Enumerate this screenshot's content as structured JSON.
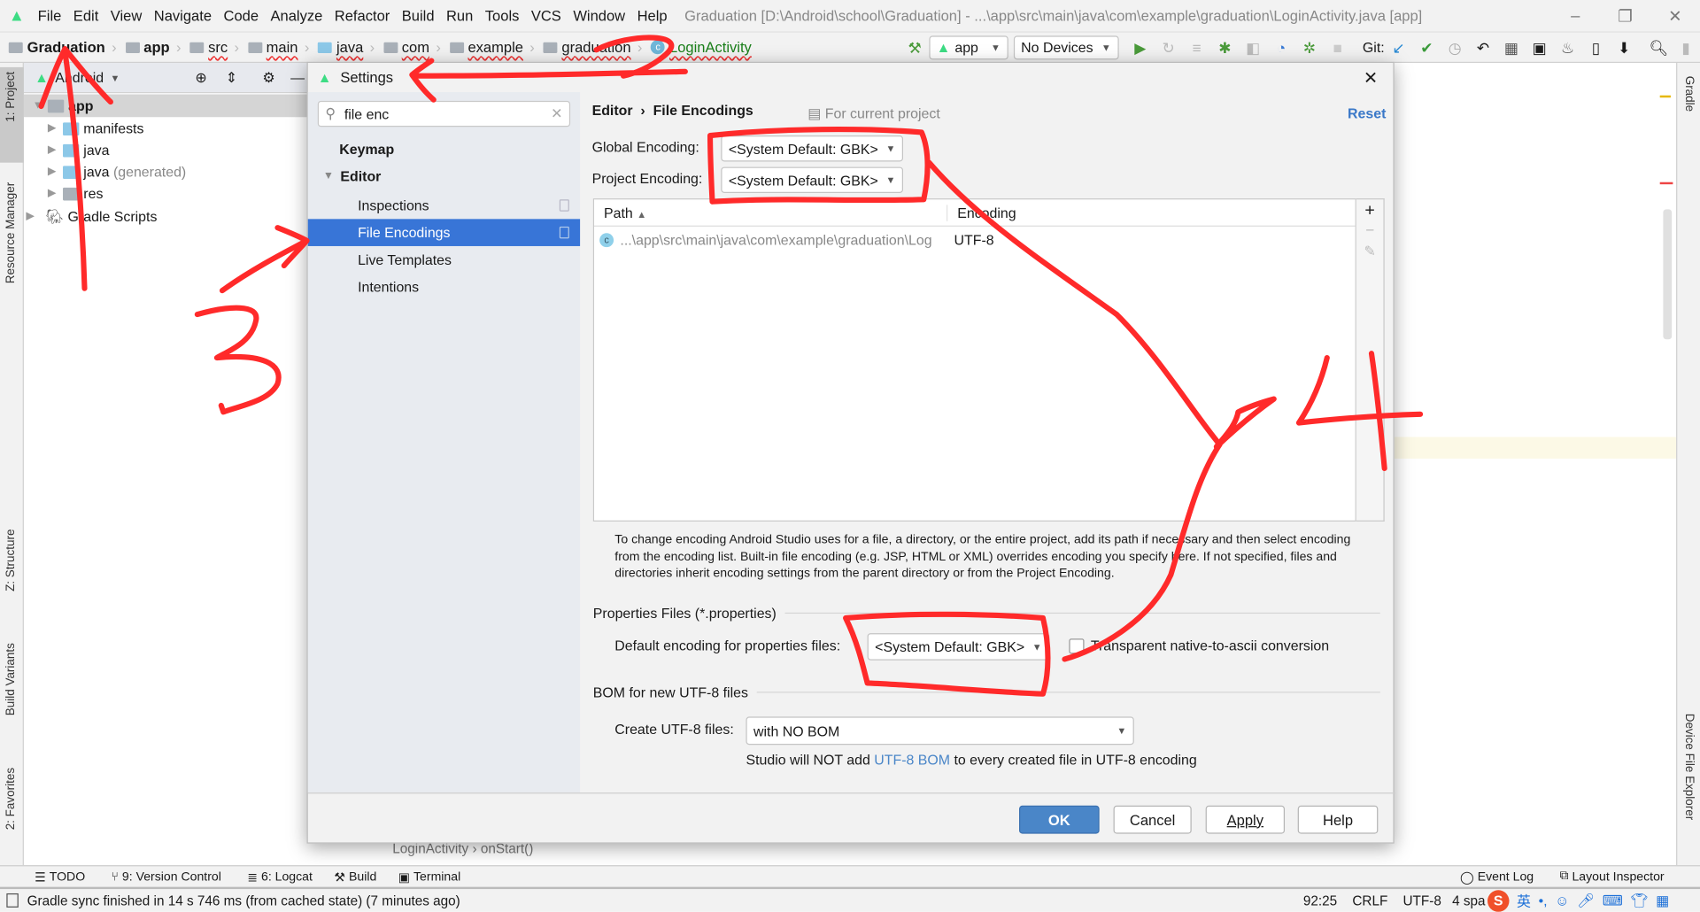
{
  "window": {
    "title": "Graduation [D:\\Android\\school\\Graduation] - ...\\app\\src\\main\\java\\com\\example\\graduation\\LoginActivity.java [app]",
    "menu": [
      "File",
      "Edit",
      "View",
      "Navigate",
      "Code",
      "Analyze",
      "Refactor",
      "Build",
      "Run",
      "Tools",
      "VCS",
      "Window",
      "Help"
    ],
    "controls": {
      "minimize": "–",
      "restore": "❐",
      "close": "✕"
    }
  },
  "navbar": {
    "breadcrumbs": [
      "Graduation",
      "app",
      "src",
      "main",
      "java",
      "com",
      "example",
      "graduation",
      "LoginActivity"
    ],
    "run_config": "app",
    "device": "No Devices",
    "git_label": "Git:"
  },
  "left_strip": [
    "1: Project",
    "Resource Manager",
    "Z: Structure",
    "Build Variants",
    "2: Favorites"
  ],
  "right_strip": [
    "Gradle",
    "Device File Explorer"
  ],
  "project": {
    "view": "Android",
    "tree": [
      {
        "label": "app",
        "bold": true
      },
      {
        "label": "manifests"
      },
      {
        "label": "java"
      },
      {
        "label": "java",
        "suffix": "(generated)"
      },
      {
        "label": "res"
      },
      {
        "label": "Gradle Scripts"
      }
    ]
  },
  "editor": {
    "breadcrumb": [
      "LoginActivity",
      "onStart()"
    ]
  },
  "dialog": {
    "title": "Settings",
    "search_value": "file enc",
    "nav": [
      {
        "label": "Keymap"
      },
      {
        "label": "Editor"
      },
      {
        "label": "Inspections"
      },
      {
        "label": "File Encodings",
        "selected": true
      },
      {
        "label": "Live Templates"
      },
      {
        "label": "Intentions"
      }
    ],
    "breadcrumb": [
      "Editor",
      "File Encodings"
    ],
    "scope": "For current project",
    "reset": "Reset",
    "global_encoding_label": "Global Encoding:",
    "global_encoding_value": "<System Default: GBK>",
    "project_encoding_label": "Project Encoding:",
    "project_encoding_value": "<System Default: GBK>",
    "table": {
      "columns": [
        "Path",
        "Encoding"
      ],
      "rows": [
        {
          "path": "...\\app\\src\\main\\java\\com\\example\\graduation\\Log",
          "encoding": "UTF-8"
        }
      ]
    },
    "description": "To change encoding Android Studio uses for a file, a directory, or the entire project, add its path if necessary and then select encoding from the encoding list. Built-in file encoding (e.g. JSP, HTML or XML) overrides encoding you specify here. If not specified, files and directories inherit encoding settings from the parent directory or from the Project Encoding.",
    "properties_section": "Properties Files (*.properties)",
    "properties_label": "Default encoding for properties files:",
    "properties_value": "<System Default: GBK>",
    "native_ascii_label": "Transparent native-to-ascii conversion",
    "native_ascii_checked": false,
    "bom_section": "BOM for new UTF-8 files",
    "bom_label": "Create UTF-8 files:",
    "bom_value": "with NO BOM",
    "bom_note_pre": "Studio will NOT add ",
    "bom_note_link": "UTF-8 BOM",
    "bom_note_post": " to every created file in UTF-8 encoding",
    "buttons": {
      "ok": "OK",
      "cancel": "Cancel",
      "apply": "Apply",
      "help": "Help"
    }
  },
  "bottom_tools": [
    "TODO",
    "9: Version Control",
    "6: Logcat",
    "Build",
    "Terminal"
  ],
  "bottom_tools_right": [
    "Event Log",
    "Layout Inspector"
  ],
  "status": {
    "message": "Gradle sync finished in 14 s 746 ms (from cached state) (7 minutes ago)",
    "position": "92:25",
    "line_sep": "CRLF",
    "encoding": "UTF-8",
    "indent": "4 spa"
  },
  "colors": {
    "accent": "#3875d7",
    "annotation": "#ff2a2a",
    "android_green": "#3ddc84",
    "link": "#4a86c8"
  }
}
